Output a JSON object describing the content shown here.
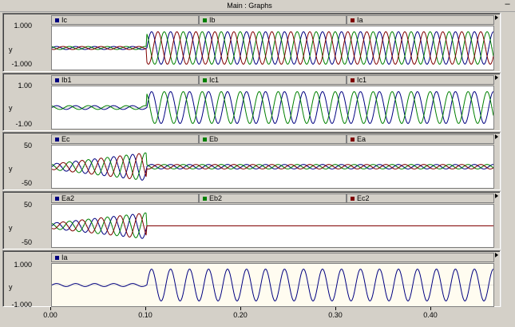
{
  "window": {
    "title": "Main : Graphs",
    "minimize_glyph": "–"
  },
  "x_axis": {
    "ticks": [
      "0.00",
      "0.10",
      "0.20",
      "0.30",
      "0.40"
    ]
  },
  "graphs": [
    {
      "y_name": "y",
      "y_max": "1.000",
      "y_min": "-1.000",
      "bg": "#ffffff",
      "legend": [
        {
          "label": "Ic",
          "color": "#000080"
        },
        {
          "label": "Ib",
          "color": "#008000"
        },
        {
          "label": "Ia",
          "color": "#800000"
        }
      ]
    },
    {
      "y_name": "y",
      "y_max": "1.00",
      "y_min": "-1.00",
      "bg": "#ffffff",
      "legend": [
        {
          "label": "Ib1",
          "color": "#000080"
        },
        {
          "label": "Ic1",
          "color": "#008000"
        },
        {
          "label": "Ic1",
          "color": "#800000"
        }
      ]
    },
    {
      "y_name": "y",
      "y_max": "50",
      "y_min": "-50",
      "bg": "#ffffff",
      "legend": [
        {
          "label": "Ec",
          "color": "#000080"
        },
        {
          "label": "Eb",
          "color": "#008000"
        },
        {
          "label": "Ea",
          "color": "#800000"
        }
      ]
    },
    {
      "y_name": "y",
      "y_max": "50",
      "y_min": "-50",
      "bg": "#ffffff",
      "legend": [
        {
          "label": "Ea2",
          "color": "#000080"
        },
        {
          "label": "Eb2",
          "color": "#008000"
        },
        {
          "label": "Ec2",
          "color": "#800000"
        }
      ]
    },
    {
      "y_name": "y",
      "y_max": "1.000",
      "y_min": "-1.000",
      "bg": "#fffcf0",
      "legend": [
        {
          "label": "Ia",
          "color": "#000080"
        }
      ]
    }
  ]
}
